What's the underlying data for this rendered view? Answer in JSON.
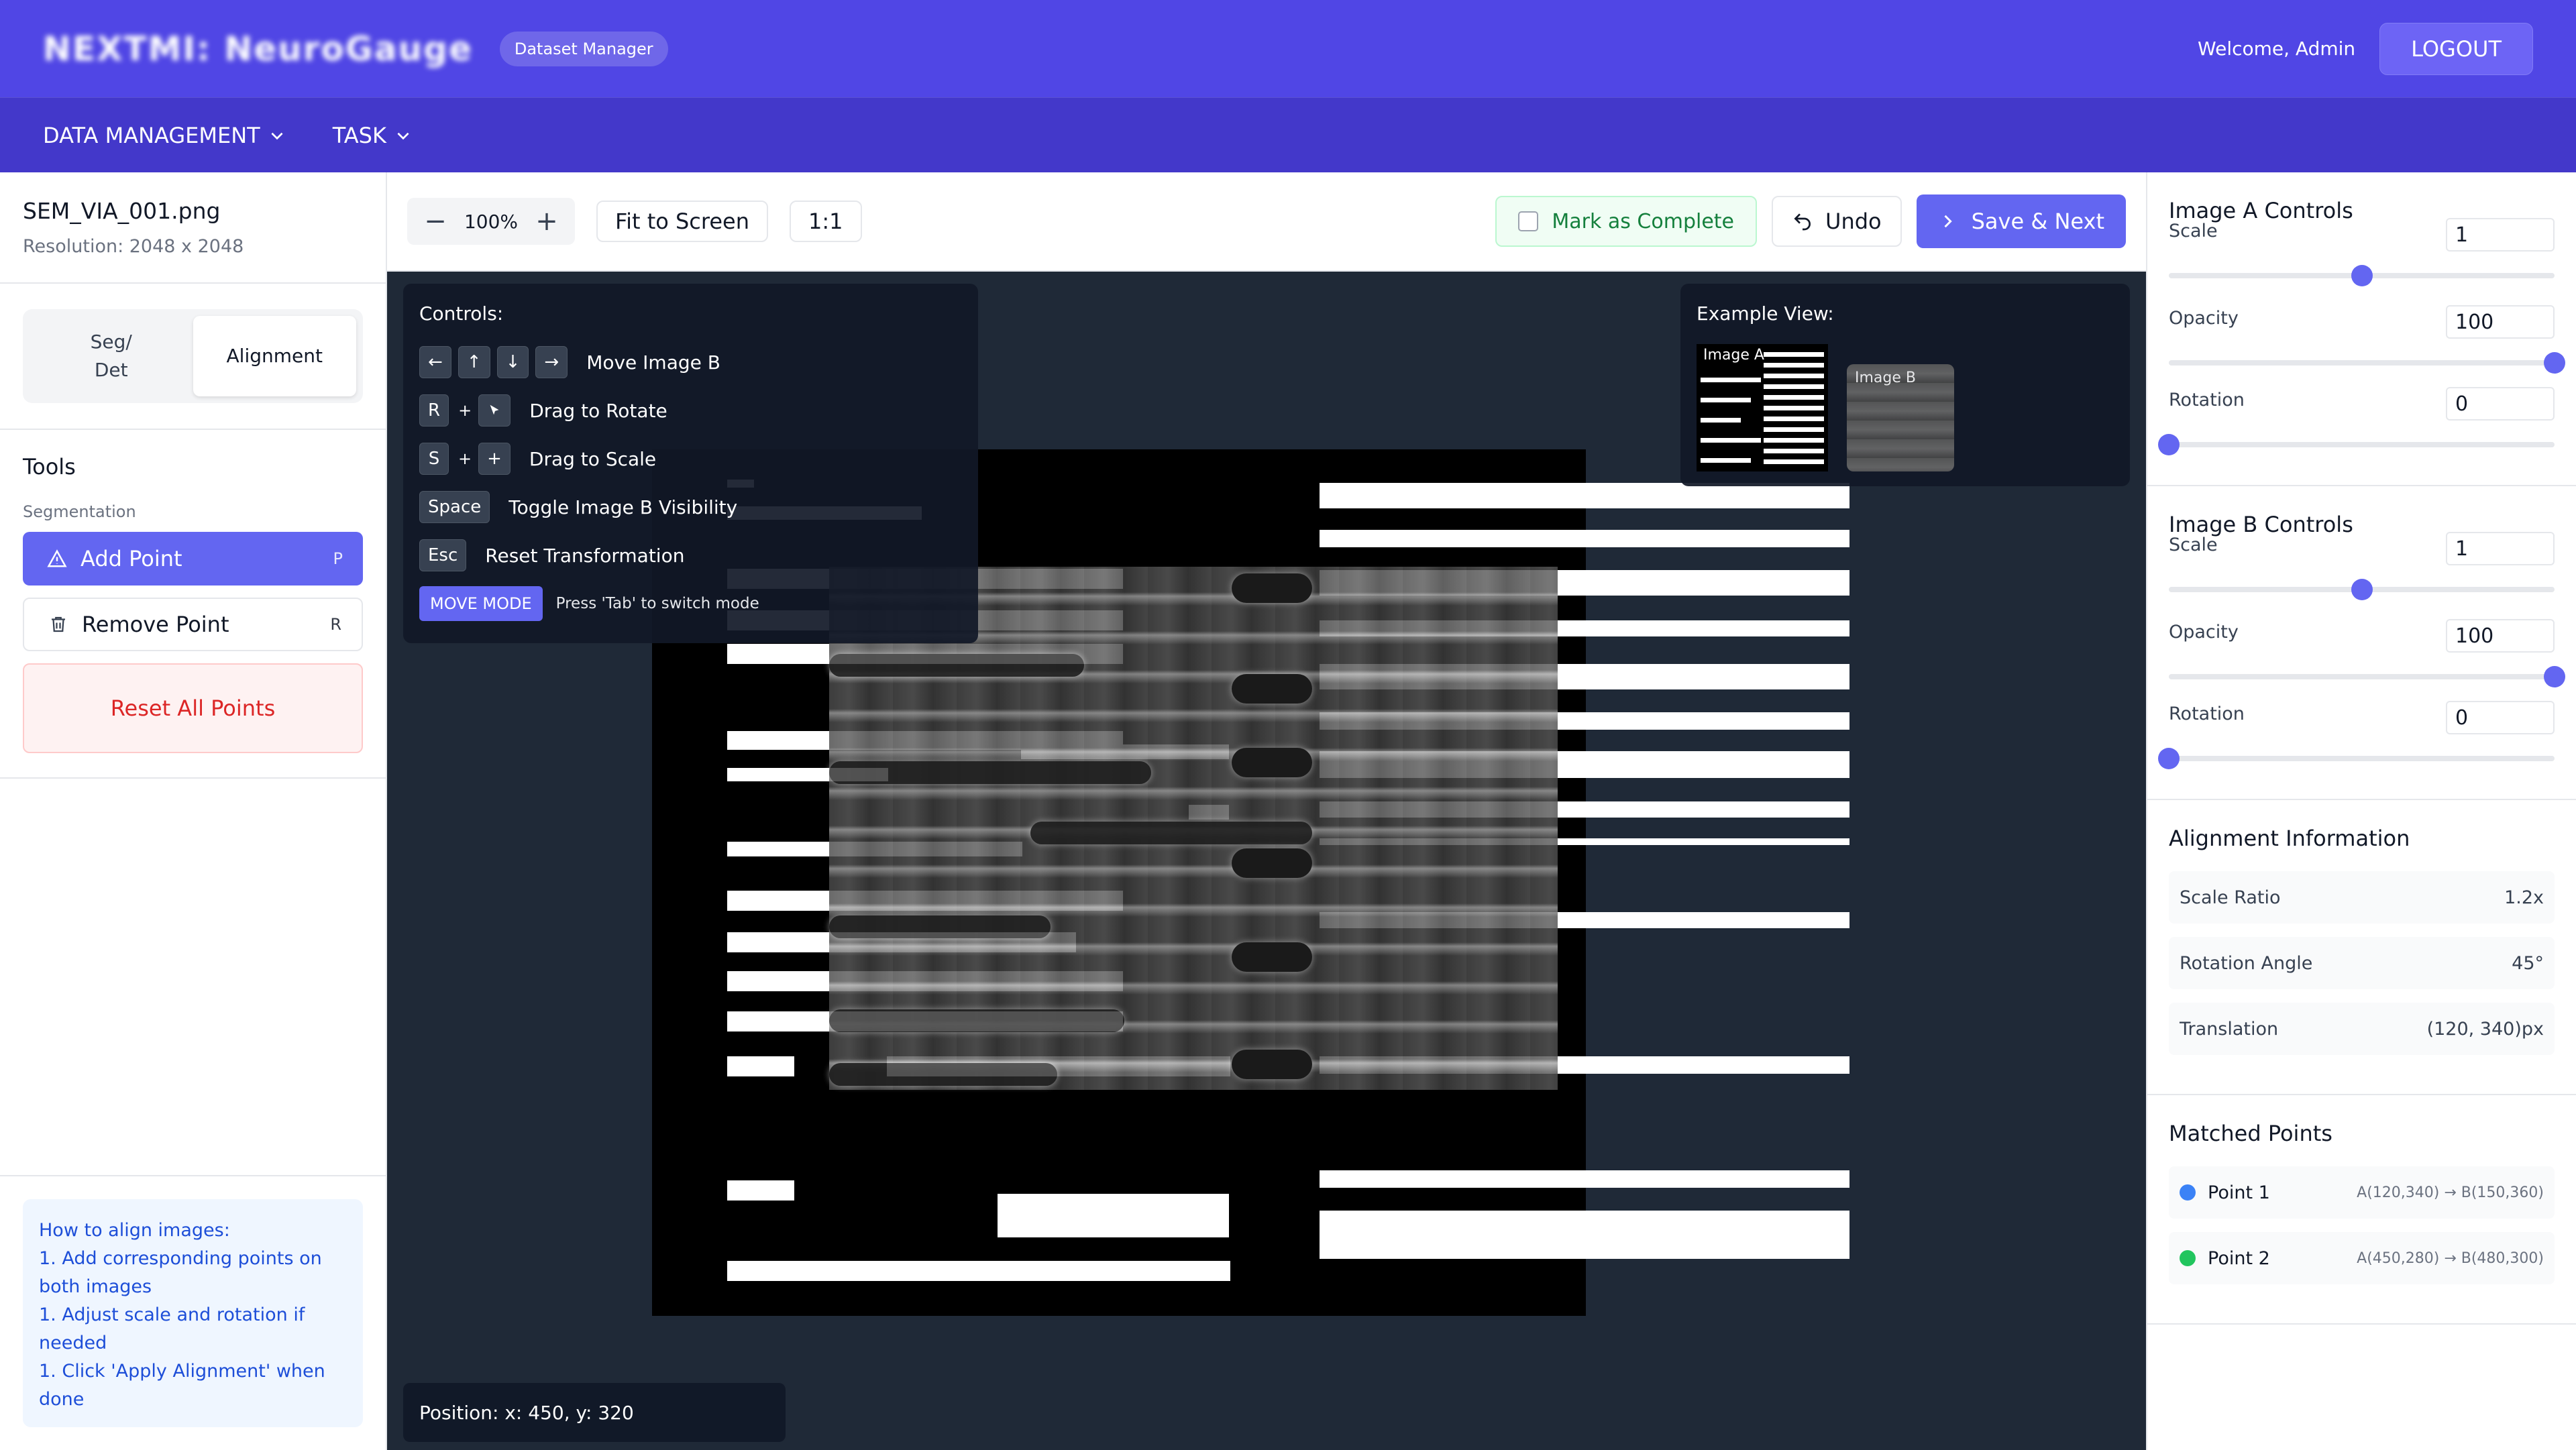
{
  "header": {
    "brand": "NEXTMI: NeuroGauge",
    "badge": "Dataset Manager",
    "welcome": "Welcome, Admin",
    "logout": "LOGOUT",
    "bg_color": "#5046e5"
  },
  "nav": {
    "items": [
      {
        "label": "DATA MANAGEMENT",
        "icon": "chevron-down-icon"
      },
      {
        "label": "TASK",
        "icon": "chevron-down-icon"
      }
    ]
  },
  "file": {
    "name": "SEM_VIA_001.png",
    "resolution": "Resolution: 2048 x 2048"
  },
  "mode": {
    "options": [
      "Seg/\nDet",
      "Alignment"
    ],
    "selected": "Alignment"
  },
  "tools": {
    "title": "Tools",
    "section": "Segmentation",
    "add_point": {
      "label": "Add Point",
      "key": "P",
      "icon": "warning-triangle-icon"
    },
    "remove_point": {
      "label": "Remove Point",
      "key": "R",
      "icon": "trash-icon"
    },
    "reset_label": "Reset All Points"
  },
  "help": {
    "lines": [
      "How to align images:",
      "1. Add corresponding points on both images",
      "1. Adjust scale and rotation if needed",
      "1. Click 'Apply Alignment' when done"
    ]
  },
  "toolbar": {
    "zoom": "100%",
    "fit_label": "Fit to Screen",
    "one_to_one": "1:1",
    "mark_label": "Mark as Complete",
    "undo_label": "Undo",
    "save_label": "Save & Next"
  },
  "controls_panel": {
    "title": "Controls:",
    "rows": [
      {
        "keys": [
          "←",
          "↑",
          "↓",
          "→"
        ],
        "label": "Move Image B"
      },
      {
        "keys": [
          "R",
          "+",
          "cursor-icon"
        ],
        "label": "Drag to Rotate"
      },
      {
        "keys": [
          "S",
          "+",
          "+"
        ],
        "label": "Drag to Scale"
      },
      {
        "keys": [
          "Space"
        ],
        "label": "Toggle Image B Visibility"
      },
      {
        "keys": [
          "Esc"
        ],
        "label": "Reset Transformation"
      }
    ],
    "mode_badge": "MOVE MODE",
    "mode_hint": "Press 'Tab' to switch mode"
  },
  "example": {
    "title": "Example View:",
    "image_a_label": "Image A",
    "image_b_label": "Image B"
  },
  "position": {
    "text": "Position: x: 450, y: 320"
  },
  "image_a_controls": {
    "title": "Image A Controls",
    "scale": {
      "label": "Scale",
      "value": "1",
      "fraction": 0.5
    },
    "opacity": {
      "label": "Opacity",
      "value": "100",
      "fraction": 1.0
    },
    "rotation": {
      "label": "Rotation",
      "value": "0",
      "fraction": 0.0
    }
  },
  "image_b_controls": {
    "title": "Image B Controls",
    "scale": {
      "label": "Scale",
      "value": "1",
      "fraction": 0.5
    },
    "opacity": {
      "label": "Opacity",
      "value": "100",
      "fraction": 1.0
    },
    "rotation": {
      "label": "Rotation",
      "value": "0",
      "fraction": 0.0
    }
  },
  "alignment_info": {
    "title": "Alignment Information",
    "rows": [
      {
        "label": "Scale Ratio",
        "value": "1.2x"
      },
      {
        "label": "Rotation Angle",
        "value": "45°"
      },
      {
        "label": "Translation",
        "value": "(120, 340)px"
      }
    ]
  },
  "matched_points": {
    "title": "Matched Points",
    "items": [
      {
        "label": "Point 1",
        "coords": "A(120,340) → B(150,360)",
        "color": "#3b82f6"
      },
      {
        "label": "Point 2",
        "coords": "A(450,280) → B(480,300)",
        "color": "#22c55e"
      }
    ]
  }
}
